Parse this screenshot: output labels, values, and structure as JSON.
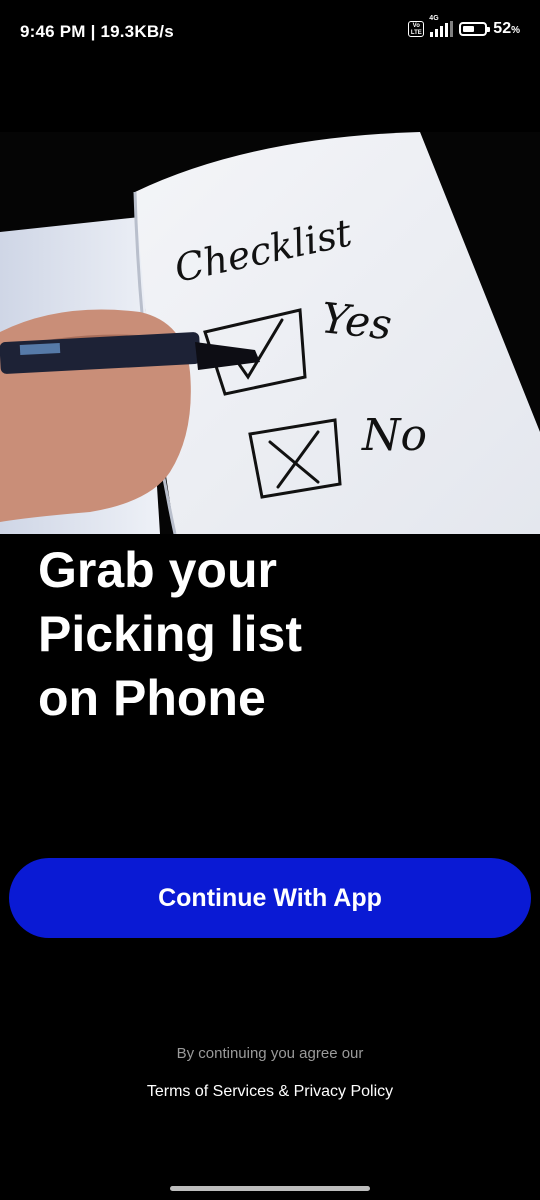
{
  "status_bar": {
    "time_speed": "9:46 PM | 19.3KB/s",
    "volte_label": "Vo\nLTE",
    "network_type": "4G",
    "battery_percent": "52",
    "battery_unit": "%",
    "battery_level": 0.52
  },
  "hero": {
    "icon": "checklist-photo",
    "checklist_title": "Checklist",
    "yes_label": "Yes",
    "no_label": "No"
  },
  "headline": {
    "line1": "Grab your",
    "line2": "Picking list",
    "line3": "on Phone"
  },
  "cta": {
    "label": "Continue With App",
    "color": "#0a1ad4"
  },
  "footer": {
    "consent_text": "By continuing you agree our",
    "policy_link": "Terms of Services & Privacy Policy"
  }
}
